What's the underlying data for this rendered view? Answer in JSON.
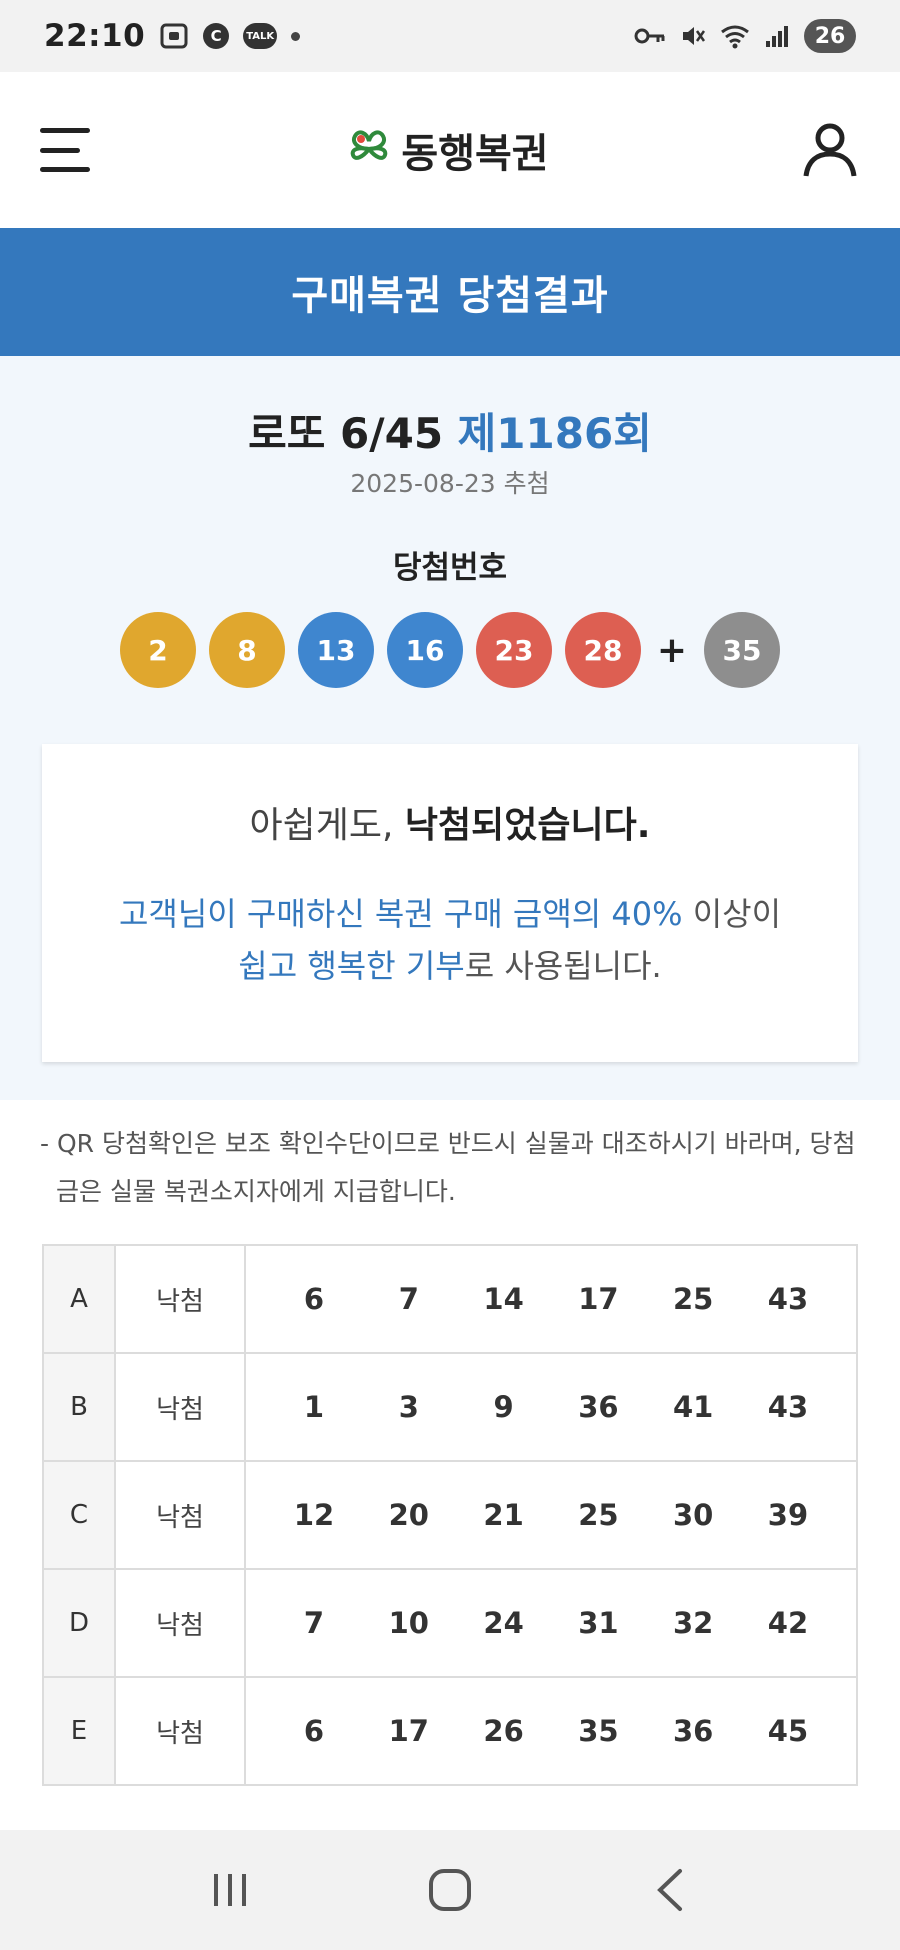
{
  "status_bar": {
    "time": "22:10",
    "talk_label": "TALK",
    "c_label": "C",
    "battery": "26"
  },
  "header": {
    "logo_text": "동행복권"
  },
  "banner": {
    "title": "구매복권 당첨결과"
  },
  "draw": {
    "game": "로또 6/45",
    "round": "제1186회",
    "date": "2025-08-23 추첨",
    "winning_label": "당첨번호",
    "numbers": [
      "2",
      "8",
      "13",
      "16",
      "23",
      "28"
    ],
    "plus": "+",
    "bonus": "35",
    "ball_colors": {
      "yellow": "#e0a72e",
      "blue": "#3f86cf",
      "red": "#dd5f52",
      "gray": "#8e8e8e"
    }
  },
  "result": {
    "prefix": "아쉽게도, ",
    "message": "낙첨되었습니다.",
    "donate_hl1": "고객님이 구매하신 복권 구매 금액의 40%",
    "donate_text1": " 이상이",
    "donate_hl2": "쉽고 행복한 기부",
    "donate_text2": "로 사용됩니다."
  },
  "notice": "- QR 당첨확인은 보조 확인수단이므로 반드시 실물과 대조하시기 바라며, 당첨금은 실물 복권소지자에게 지급합니다.",
  "tickets": [
    {
      "game": "A",
      "status": "낙첨",
      "numbers": [
        "6",
        "7",
        "14",
        "17",
        "25",
        "43"
      ]
    },
    {
      "game": "B",
      "status": "낙첨",
      "numbers": [
        "1",
        "3",
        "9",
        "36",
        "41",
        "43"
      ]
    },
    {
      "game": "C",
      "status": "낙첨",
      "numbers": [
        "12",
        "20",
        "21",
        "25",
        "30",
        "39"
      ]
    },
    {
      "game": "D",
      "status": "낙첨",
      "numbers": [
        "7",
        "10",
        "24",
        "31",
        "32",
        "42"
      ]
    },
    {
      "game": "E",
      "status": "낙첨",
      "numbers": [
        "6",
        "17",
        "26",
        "35",
        "36",
        "45"
      ]
    }
  ],
  "icons": {
    "menu": "hamburger-menu-icon",
    "user": "user-icon",
    "recents": "recents-icon",
    "home": "home-icon",
    "back": "back-icon"
  }
}
